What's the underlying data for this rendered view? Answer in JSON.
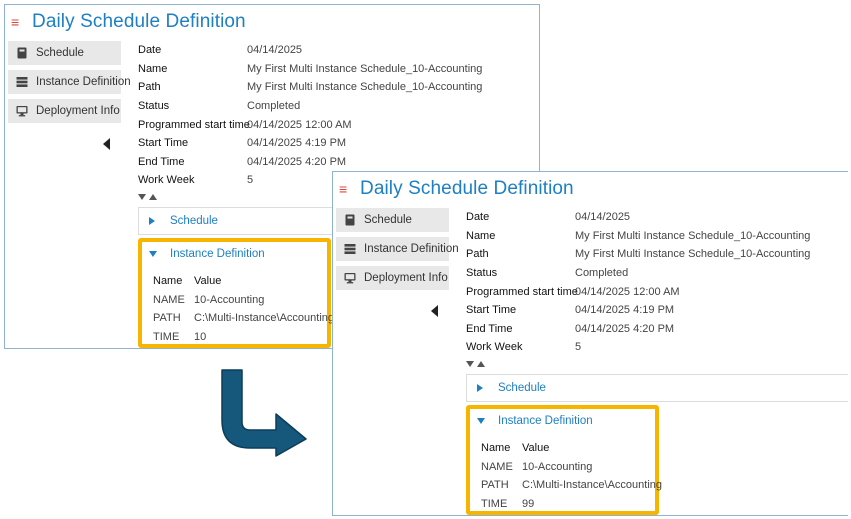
{
  "title": "Daily Schedule Definition",
  "sidebar": {
    "items": [
      {
        "label": "Schedule",
        "icon": "book-icon"
      },
      {
        "label": "Instance Definition",
        "icon": "server-icon"
      },
      {
        "label": "Deployment Info",
        "icon": "monitor-icon"
      }
    ]
  },
  "details": {
    "rows": [
      {
        "label": "Date",
        "value": "04/14/2025"
      },
      {
        "label": "Name",
        "value": "My First Multi Instance Schedule_10-Accounting"
      },
      {
        "label": "Path",
        "value": "My First Multi Instance Schedule_10-Accounting"
      },
      {
        "label": "Status",
        "value": "Completed"
      },
      {
        "label": "Programmed start time",
        "value": "04/14/2025 12:00 AM"
      },
      {
        "label": "Start Time",
        "value": "04/14/2025 4:19 PM"
      },
      {
        "label": "End Time",
        "value": "04/14/2025 4:20 PM"
      },
      {
        "label": "Work Week",
        "value": "5"
      }
    ]
  },
  "sections": {
    "schedule_label": "Schedule",
    "instance_label": "Instance Definition"
  },
  "instance_table": {
    "headers": [
      "Name",
      "Value"
    ],
    "before": [
      {
        "name": "NAME",
        "value": "10-Accounting"
      },
      {
        "name": "PATH",
        "value": "C:\\Multi-Instance\\Accounting"
      },
      {
        "name": "TIME",
        "value": "10"
      }
    ],
    "after": [
      {
        "name": "NAME",
        "value": "10-Accounting"
      },
      {
        "name": "PATH",
        "value": "C:\\Multi-Instance\\Accounting"
      },
      {
        "name": "TIME",
        "value": "99"
      }
    ]
  },
  "colors": {
    "accent": "#1d7fc4",
    "menu_icon": "#e0443a",
    "highlight": "#f7b500",
    "arrow": "#15587c"
  }
}
